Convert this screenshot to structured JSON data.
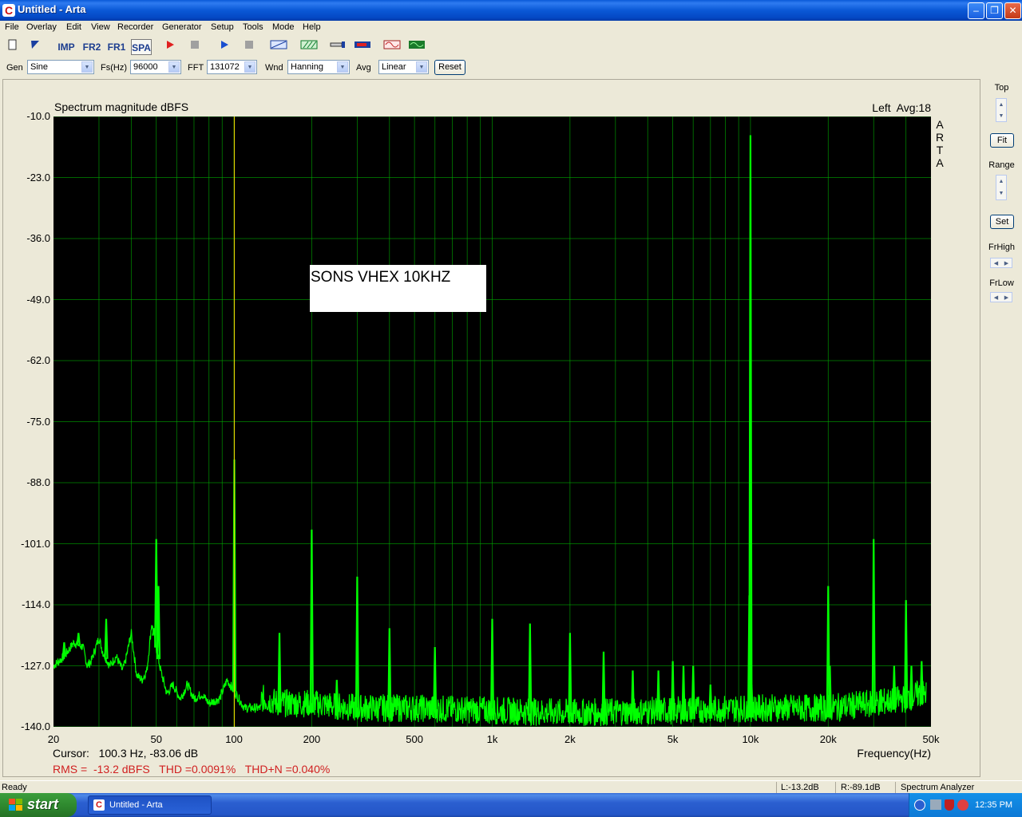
{
  "window": {
    "title": "Untitled - Arta"
  },
  "menu": [
    "File",
    "Overlay",
    "Edit",
    "View",
    "Recorder",
    "Generator",
    "Setup",
    "Tools",
    "Mode",
    "Help"
  ],
  "toolbar": {
    "imp": "IMP",
    "fr2": "FR2",
    "fr1": "FR1",
    "spa": "SPA"
  },
  "settings": {
    "gen_label": "Gen",
    "gen_value": "Sine",
    "fs_label": "Fs(Hz)",
    "fs_value": "96000",
    "fft_label": "FFT",
    "fft_value": "131072",
    "wnd_label": "Wnd",
    "wnd_value": "Hanning",
    "avg_label": "Avg",
    "avg_value": "Linear",
    "reset": "Reset"
  },
  "chart_data": {
    "type": "line",
    "title": "Spectrum magnitude dBFS",
    "channel_info": "Left  Avg:18",
    "brand_label": [
      "A",
      "R",
      "T",
      "A"
    ],
    "xlabel": "Frequency(Hz)",
    "x_scale": "log",
    "xlim": [
      20,
      50000
    ],
    "ylim": [
      -140,
      -10
    ],
    "x_ticks": [
      20,
      50,
      100,
      200,
      500,
      1000,
      2000,
      5000,
      10000,
      20000,
      50000
    ],
    "x_tick_labels": [
      "20",
      "50",
      "100",
      "200",
      "500",
      "1k",
      "2k",
      "5k",
      "10k",
      "20k",
      "50k"
    ],
    "y_ticks": [
      -10,
      -23,
      -36,
      -49,
      -62,
      -75,
      -88,
      -101,
      -114,
      -127,
      -140
    ],
    "y_tick_labels": [
      "-10.0",
      "-23.0",
      "-36.0",
      "-49.0",
      "-62.0",
      "-75.0",
      "-88.0",
      "-101.0",
      "-114.0",
      "-127.0",
      "-140.0"
    ],
    "grid": true,
    "cursor_freq": 100.3,
    "annotation": "SONS VHEX 10KHZ",
    "background_color": "#000000",
    "line_color": "#00ff00",
    "grid_color": "#00aa00",
    "cursor_color": "#e0d000",
    "noise_floor": [
      [
        20,
        -127
      ],
      [
        22,
        -125
      ],
      [
        24,
        -122
      ],
      [
        26,
        -123
      ],
      [
        27,
        -127
      ],
      [
        28,
        -126
      ],
      [
        30,
        -121
      ],
      [
        31,
        -124
      ],
      [
        33,
        -127
      ],
      [
        35,
        -125
      ],
      [
        37,
        -128
      ],
      [
        38,
        -126
      ],
      [
        40,
        -120
      ],
      [
        42,
        -129
      ],
      [
        44,
        -130
      ],
      [
        46,
        -128
      ],
      [
        48,
        -118
      ],
      [
        52,
        -128
      ],
      [
        55,
        -133
      ],
      [
        58,
        -131
      ],
      [
        62,
        -134
      ],
      [
        66,
        -131
      ],
      [
        70,
        -134
      ],
      [
        75,
        -133
      ],
      [
        80,
        -135
      ],
      [
        88,
        -134
      ],
      [
        94,
        -130
      ],
      [
        110,
        -136
      ],
      [
        130,
        -136
      ],
      [
        150,
        -137
      ],
      [
        200,
        -137
      ],
      [
        300,
        -138
      ],
      [
        500,
        -138
      ],
      [
        1000,
        -138.5
      ],
      [
        2000,
        -139
      ],
      [
        5000,
        -138.5
      ],
      [
        10000,
        -138
      ],
      [
        20000,
        -138
      ],
      [
        30000,
        -137
      ],
      [
        40000,
        -136
      ],
      [
        45000,
        -135
      ],
      [
        48000,
        -135
      ]
    ],
    "peaks": [
      {
        "freq": 22,
        "level": -122
      },
      {
        "freq": 25,
        "level": -120
      },
      {
        "freq": 32,
        "level": -117
      },
      {
        "freq": 49,
        "level": -119
      },
      {
        "freq": 50,
        "level": -100
      },
      {
        "freq": 51,
        "level": -110
      },
      {
        "freq": 100.3,
        "level": -83.06
      },
      {
        "freq": 150,
        "level": -120
      },
      {
        "freq": 200,
        "level": -98
      },
      {
        "freq": 250,
        "level": -130
      },
      {
        "freq": 300,
        "level": -108
      },
      {
        "freq": 400,
        "level": -119
      },
      {
        "freq": 600,
        "level": -123
      },
      {
        "freq": 1000,
        "level": -117
      },
      {
        "freq": 1400,
        "level": -118
      },
      {
        "freq": 2000,
        "level": -120
      },
      {
        "freq": 2700,
        "level": -124
      },
      {
        "freq": 3500,
        "level": -128
      },
      {
        "freq": 4400,
        "level": -128
      },
      {
        "freq": 5000,
        "level": -126
      },
      {
        "freq": 5500,
        "level": -127
      },
      {
        "freq": 6000,
        "level": -127
      },
      {
        "freq": 7000,
        "level": -131
      },
      {
        "freq": 9900,
        "level": -112
      },
      {
        "freq": 10000,
        "level": -14
      },
      {
        "freq": 10100,
        "level": -131
      },
      {
        "freq": 20000,
        "level": -110
      },
      {
        "freq": 20300,
        "level": -127
      },
      {
        "freq": 30000,
        "level": -100
      },
      {
        "freq": 32000,
        "level": -132
      },
      {
        "freq": 36000,
        "level": -127
      },
      {
        "freq": 40000,
        "level": -113
      },
      {
        "freq": 42000,
        "level": -127
      },
      {
        "freq": 46000,
        "level": -126
      }
    ]
  },
  "readout": {
    "cursor": "Cursor:   100.3 Hz, -83.06 dB",
    "stats": "RMS =  -13.2 dBFS   THD =0.0091%   THD+N =0.040%"
  },
  "side": {
    "top": "Top",
    "fit": "Fit",
    "range": "Range",
    "set": "Set",
    "frhigh": "FrHigh",
    "frlow": "FrLow"
  },
  "status": {
    "ready": "Ready",
    "left": "L:-13.2dB",
    "right": "R:-89.1dB",
    "mode": "Spectrum Analyzer"
  },
  "taskbar": {
    "start": "start",
    "task": "Untitled - Arta",
    "clock": "12:35 PM"
  }
}
